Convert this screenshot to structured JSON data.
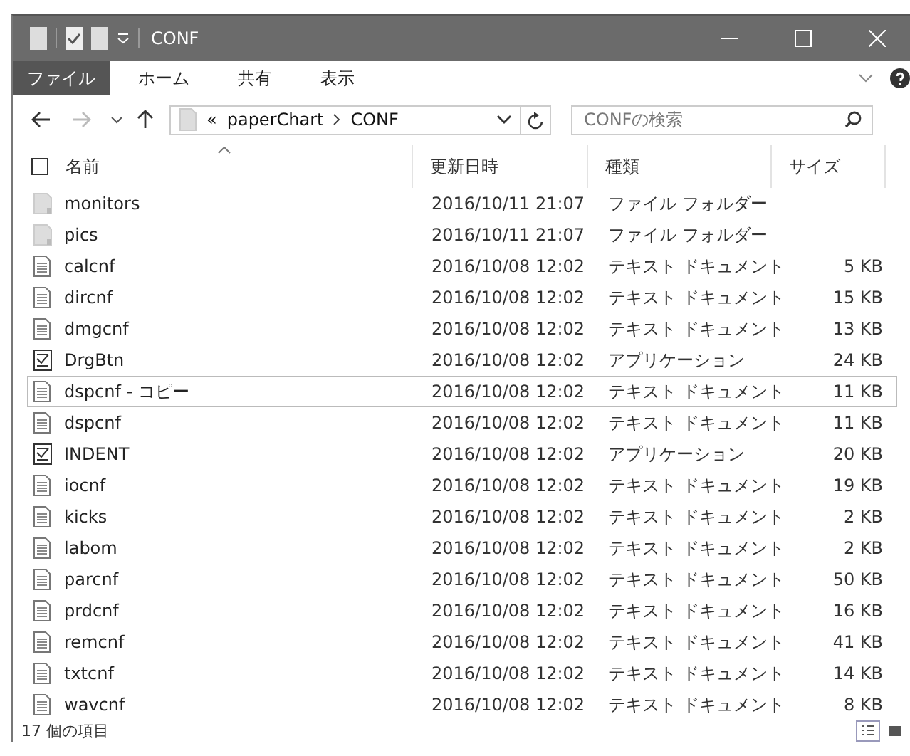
{
  "window": {
    "title": "CONF"
  },
  "ribbon_tabs": [
    {
      "label": "ファイル",
      "selected": true
    },
    {
      "label": "ホーム",
      "selected": false
    },
    {
      "label": "共有",
      "selected": false
    },
    {
      "label": "表示",
      "selected": false
    }
  ],
  "address": {
    "prefix": "«",
    "crumbs": [
      "paperChart",
      "CONF"
    ]
  },
  "search": {
    "placeholder": "CONFの検索"
  },
  "columns": [
    "名前",
    "更新日時",
    "種類",
    "サイズ"
  ],
  "rows": [
    {
      "kind": "folder",
      "name": "monitors",
      "date": "2016/10/11 21:07",
      "type": "ファイル フォルダー",
      "focused": false
    },
    {
      "kind": "folder",
      "name": "pics",
      "date": "2016/10/11 21:07",
      "type": "ファイル フォルダー",
      "focused": false
    },
    {
      "kind": "text",
      "name": "calcnf",
      "date": "2016/10/08 12:02",
      "type": "テキスト ドキュメント",
      "size": "5 KB",
      "focused": false
    },
    {
      "kind": "text",
      "name": "dircnf",
      "date": "2016/10/08 12:02",
      "type": "テキスト ドキュメント",
      "size": "15 KB",
      "focused": false
    },
    {
      "kind": "text",
      "name": "dmgcnf",
      "date": "2016/10/08 12:02",
      "type": "テキスト ドキュメント",
      "size": "13 KB",
      "focused": false
    },
    {
      "kind": "app",
      "name": "DrgBtn",
      "date": "2016/10/08 12:02",
      "type": "アプリケーション",
      "size": "24 KB",
      "focused": false
    },
    {
      "kind": "text",
      "name": "dspcnf - コピー",
      "date": "2016/10/08 12:02",
      "type": "テキスト ドキュメント",
      "size": "11 KB",
      "focused": true
    },
    {
      "kind": "text",
      "name": "dspcnf",
      "date": "2016/10/08 12:02",
      "type": "テキスト ドキュメント",
      "size": "11 KB",
      "focused": false
    },
    {
      "kind": "app",
      "name": "INDENT",
      "date": "2016/10/08 12:02",
      "type": "アプリケーション",
      "size": "20 KB",
      "focused": false
    },
    {
      "kind": "text",
      "name": "iocnf",
      "date": "2016/10/08 12:02",
      "type": "テキスト ドキュメント",
      "size": "19 KB",
      "focused": false
    },
    {
      "kind": "text",
      "name": "kicks",
      "date": "2016/10/08 12:02",
      "type": "テキスト ドキュメント",
      "size": "2 KB",
      "focused": false
    },
    {
      "kind": "text",
      "name": "labom",
      "date": "2016/10/08 12:02",
      "type": "テキスト ドキュメント",
      "size": "2 KB",
      "focused": false
    },
    {
      "kind": "text",
      "name": "parcnf",
      "date": "2016/10/08 12:02",
      "type": "テキスト ドキュメント",
      "size": "50 KB",
      "focused": false
    },
    {
      "kind": "text",
      "name": "prdcnf",
      "date": "2016/10/08 12:02",
      "type": "テキスト ドキュメント",
      "size": "16 KB",
      "focused": false
    },
    {
      "kind": "text",
      "name": "remcnf",
      "date": "2016/10/08 12:02",
      "type": "テキスト ドキュメント",
      "size": "41 KB",
      "focused": false
    },
    {
      "kind": "text",
      "name": "txtcnf",
      "date": "2016/10/08 12:02",
      "type": "テキスト ドキュメント",
      "size": "14 KB",
      "focused": false
    },
    {
      "kind": "text",
      "name": "wavcnf",
      "date": "2016/10/08 12:02",
      "type": "テキスト ドキュメント",
      "size": "8 KB",
      "focused": false
    }
  ],
  "status_bar": {
    "text": "17 個の項目",
    "views": [
      {
        "kind": "details",
        "selected": true
      },
      {
        "kind": "large",
        "selected": false
      }
    ]
  }
}
